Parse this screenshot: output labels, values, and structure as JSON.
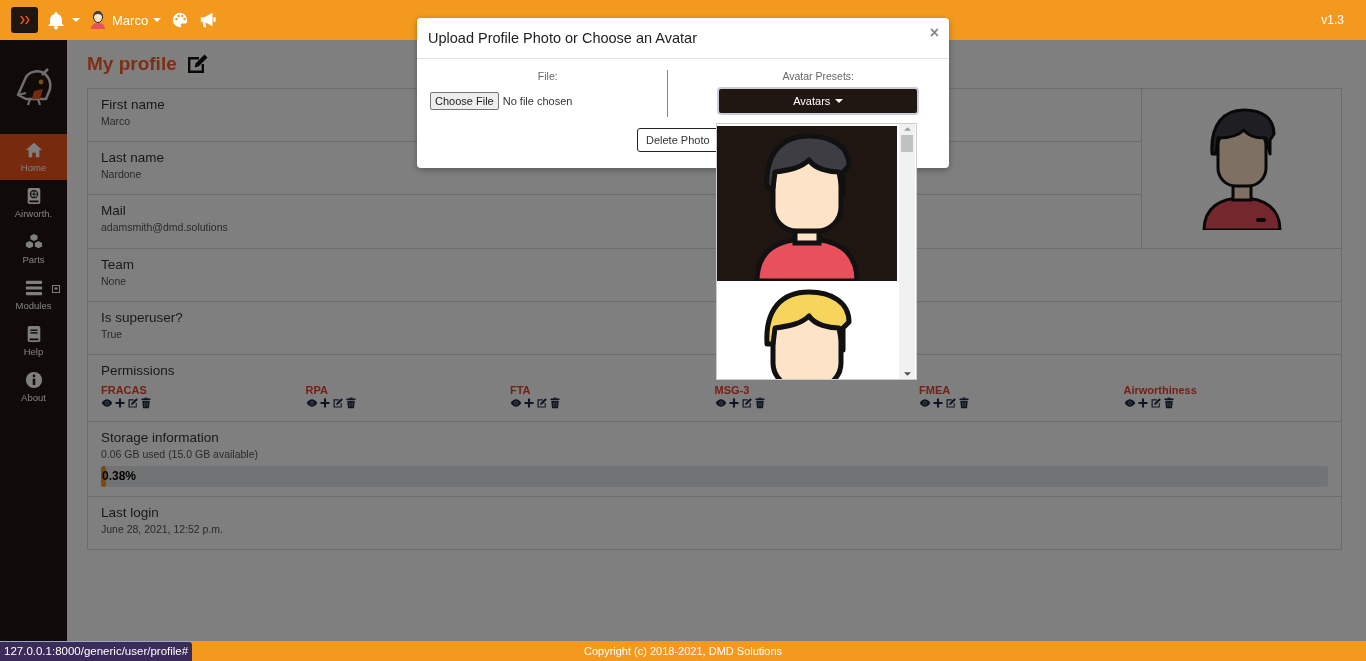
{
  "topbar": {
    "user": "Marco",
    "version": "v1.3"
  },
  "sidebar": {
    "items": [
      {
        "label": "Home",
        "selected": true
      },
      {
        "label": "Airworth.",
        "selected": false
      },
      {
        "label": "Parts",
        "selected": false
      },
      {
        "label": "Modules",
        "selected": false
      },
      {
        "label": "Help",
        "selected": false
      },
      {
        "label": "About",
        "selected": false
      }
    ]
  },
  "page": {
    "title": "My profile"
  },
  "profile": {
    "fields": [
      {
        "label": "First name",
        "value": "Marco"
      },
      {
        "label": "Last name",
        "value": "Nardone"
      },
      {
        "label": "Mail",
        "value": "adamsmith@dmd.solutions"
      },
      {
        "label": "Team",
        "value": "None"
      },
      {
        "label": "Is superuser?",
        "value": "True"
      }
    ],
    "permissions": {
      "label": "Permissions",
      "modules": [
        "FRACAS",
        "RPA",
        "FTA",
        "MSG-3",
        "FMEA",
        "Airworthiness"
      ]
    },
    "storage": {
      "label": "Storage information",
      "detail": "0.06 GB used (15.0 GB available)",
      "level": 0.0038,
      "reading": "0.38%"
    },
    "last_login": {
      "label": "Last login",
      "value": "June 28, 2021, 12:52 p.m."
    }
  },
  "modal": {
    "title": "Upload Profile Photo or Choose an Avatar",
    "close": "×",
    "file_label": "File:",
    "file_button": "Choose File",
    "file_status": "No file chosen",
    "avatar_label": "Avatar Presets:",
    "dropdown": "Avatars",
    "delete_button": "Delete Photo"
  },
  "footer": {
    "url": "127.0.0.1:8000/generic/user/profile#",
    "copyright": "Copyright (c) 2018-2021, DMD Solutions"
  }
}
